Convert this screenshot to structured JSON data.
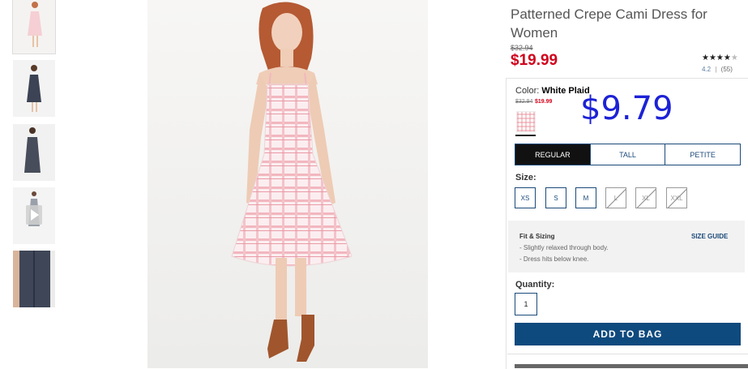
{
  "product": {
    "title": "Patterned Crepe Cami Dress for Women",
    "original_price": "$32.94",
    "sale_price": "$19.99",
    "rating_stars": "★★★★",
    "rating_star_off": "★",
    "rating_value": "4.2",
    "rating_count": "(55)",
    "rating_separator": "|"
  },
  "color": {
    "label": "Color:",
    "name": "White Plaid",
    "original_price": "$32.94",
    "sale_price": "$19.99"
  },
  "overlay_price": "$9.79",
  "fit_tabs": [
    "REGULAR",
    "TALL",
    "PETITE"
  ],
  "sizes": {
    "label": "Size:",
    "options": [
      "XS",
      "S",
      "M",
      "L",
      "XL",
      "XXL"
    ]
  },
  "fit_sizing": {
    "title": "Fit & Sizing",
    "guide_link": "SIZE GUIDE",
    "items": [
      "- Slightly relaxed through body.",
      "- Dress hits below knee."
    ]
  },
  "quantity": {
    "label": "Quantity:",
    "value": "1"
  },
  "add_to_bag": "ADD TO BAG",
  "colors": {
    "sale_red": "#d0021b",
    "brand_navy": "#0f4a7e",
    "overlay_blue": "#1d22d6"
  }
}
